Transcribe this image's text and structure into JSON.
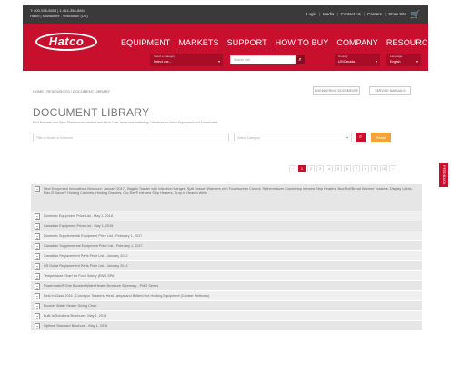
{
  "topbar": {
    "contact_lines": [
      "T: 800-558-8653 | 1-414-358-8840",
      "Hatco | Milwaukee - Wisconsin (US)"
    ],
    "links": [
      "Login",
      "Media",
      "Contact Us",
      "Careers",
      "Store Site"
    ]
  },
  "header": {
    "logo_text": "Hatco",
    "nav": [
      "EQUIPMENT",
      "MARKETS",
      "SUPPORT",
      "HOW TO BUY",
      "COMPANY",
      "RESOURCES"
    ],
    "selects": [
      {
        "label": "Select a Category",
        "value": "Select one..."
      },
      {
        "label": "Country",
        "value": "US/Canada"
      },
      {
        "label": "Language",
        "value": "English"
      }
    ],
    "search_placeholder": "Search Site"
  },
  "breadcrumb": "HOME / RESOURCES / DOCUMENT LIBRARY",
  "buttons": {
    "btn1": "ENGINEERING DOCUMENTS",
    "btn2": "SERVICE MANUALS"
  },
  "page": {
    "title": "DOCUMENT LIBRARY",
    "description": "Find Manuals and Spec Sheets in the section and Price Lists, news and marketing. Literature on Hatco Equipment and Accessories."
  },
  "filters": {
    "keyword_placeholder": "Title or Model or Keyword",
    "type_placeholder": "Select Category",
    "go_label": "Reset"
  },
  "pagination": [
    "‹",
    "1",
    "2",
    "3",
    "4",
    "5",
    "6",
    "7",
    "8",
    "9",
    "10",
    "›"
  ],
  "side_tab": "FEEDBACK",
  "documents": [
    "New Equipment Innovations Brochure: January 2017 - Bagels Toaster with Induction Ranges, Split Drawer Warmers with Touchscreen Control, Rethermalizer Countertop Infrared Strip Heaters, Bun/Roll/Bread Warmer Toasters, Display Lights, Flav-R-Savor® Holding Cabinets, Holding Drawers, Glo-Ray® Infrared Strip Heaters, Drop-In Heated Wells",
    "Domestic Equipment Price List - May 1, 2018",
    "Canadian Equipment Price List - May 1, 2018",
    "Domestic Supplemental Equipment Price List - February 1, 2017",
    "Canadian Supplemental Equipment Price List - February 1, 2017",
    "Canadian Replacement Parts Price List - January 2012",
    "US Dollar Replacement Parts Price List - January 2012",
    "Temperature Chart for Food Safety (ENG,SPA)",
    "Powermatic® One Booster Water Heater Brochure Summary - PMG Series",
    "Best in Class 2016 - Conveyor Toasters, Heat Lamps and Bottled Hot Holding Equipment (Greater Wellness)",
    "Booster Water Heater Sizing Chart",
    "Built-In Solutions Brochure - May 1, 2018",
    "Optimal Standard Brochure - May 1, 2018"
  ]
}
